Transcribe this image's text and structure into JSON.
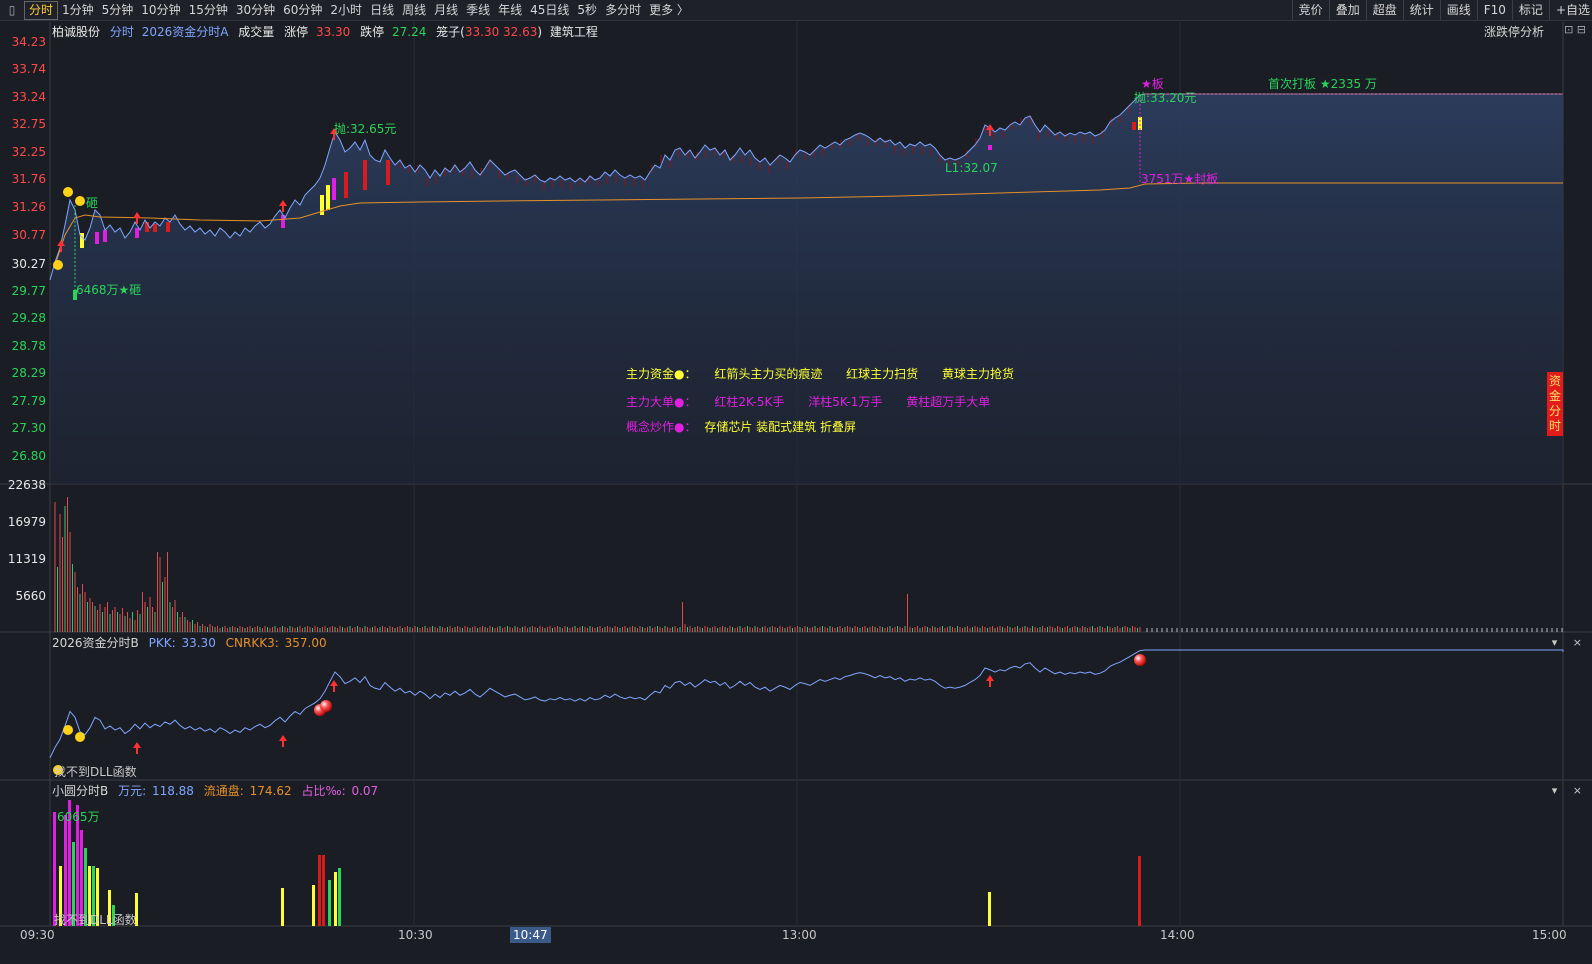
{
  "topbar": {
    "menu_icon": "menu-icon",
    "periods": [
      "分时",
      "1分钟",
      "5分钟",
      "10分钟",
      "15分钟",
      "30分钟",
      "60分钟",
      "2小时",
      "日线",
      "周线",
      "月线",
      "季线",
      "年线",
      "45日线",
      "5秒",
      "多分时",
      "更多 〉"
    ],
    "tools": [
      "竞价",
      "叠加",
      "超盘",
      "统计",
      "画线",
      "F10",
      "标记",
      "+自选"
    ]
  },
  "info": {
    "name": "柏诚股份",
    "mode": "分时",
    "indicator": "2026资金分时A",
    "volume_label": "成交量",
    "limit_up_label": "涨停",
    "limit_up": "33.30",
    "limit_down_label": "跌停",
    "limit_down": "27.24",
    "cage_prefix": "笼子(",
    "cage_value": "33.30 32.63",
    "cage_suffix": ")",
    "sector": "建筑工程",
    "analysis_button": "涨跌停分析"
  },
  "price_axis": {
    "up": [
      "34.23",
      "33.74",
      "33.24",
      "32.75",
      "32.25",
      "31.76",
      "31.26",
      "30.77"
    ],
    "base": "30.27",
    "down": [
      "29.77",
      "29.28",
      "28.78",
      "28.29",
      "27.79",
      "27.30",
      "26.80"
    ]
  },
  "volume_axis": [
    "22638",
    "16979",
    "11319",
    "5660"
  ],
  "annotations": {
    "sell1": "抛:32.65元",
    "sell2": "抛:33.20元",
    "board_star": "★板",
    "first_board": "首次打板 ★2335 万",
    "seal": "3751万★封板",
    "low": "L1:32.07",
    "smash_small": "砸",
    "smash": "6468万★砸"
  },
  "legend": {
    "row1": [
      "主力资金●：",
      "红箭头主力买的痕迹",
      "红球主力扫货",
      "黄球主力抢货"
    ],
    "row2": [
      "主力大单●：",
      "红柱2K-5K手",
      "洋柱5K-1万手",
      "黄柱超万手大单"
    ],
    "row3_label": "概念炒作●：",
    "row3_value": "存储芯片 装配式建筑 折叠屏"
  },
  "panel_b": {
    "title": "2026资金分时B",
    "pkk_label": "PKK:",
    "pkk": "33.30",
    "cnrkk_label": "CNRKK3:",
    "cnrkk": "357.00",
    "dll_text": "找不到DLL函数"
  },
  "panel_c": {
    "title": "小圆分时B",
    "wan_label": "万元:",
    "wan": "118.88",
    "float_label": "流通盘:",
    "float": "174.62",
    "ratio_label": "占比‰:",
    "ratio": "0.07",
    "bar_label": "6065万",
    "dll_text": "找不到DLL函数"
  },
  "time_axis": {
    "labels": [
      "09:30",
      "10:30",
      "13:00",
      "14:00",
      "15:00"
    ],
    "cursor": "10:47"
  },
  "side_button": "资金分时",
  "panel_ctrl": "▾ ×",
  "colors": {
    "up": "#ff4a4a",
    "down": "#2ad45a",
    "price_line": "#7fa6ff",
    "avg_line": "#e6902a",
    "magenta": "#e020e0",
    "yellow": "#ffff33"
  }
}
